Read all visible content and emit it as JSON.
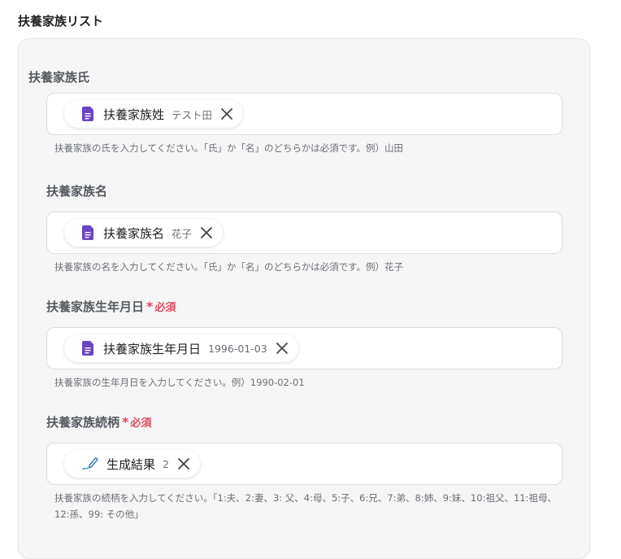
{
  "section_title": "扶養家族リスト",
  "fields": [
    {
      "label": "扶養家族氏",
      "required": false,
      "chip": {
        "icon": "document-icon",
        "label": "扶養家族姓",
        "value": "テスト田"
      },
      "help": "扶養家族の氏を入力してください。「氏」か「名」のどちらかは必須です。例）山田"
    },
    {
      "label": "扶養家族名",
      "required": false,
      "chip": {
        "icon": "document-icon",
        "label": "扶養家族名",
        "value": "花子"
      },
      "help": "扶養家族の名を入力してください。「氏」か「名」のどちらかは必須です。例）花子"
    },
    {
      "label": "扶養家族生年月日",
      "required": true,
      "required_text": "必須",
      "chip": {
        "icon": "document-icon",
        "label": "扶養家族生年月日",
        "value": "1996-01-03"
      },
      "help": "扶養家族の生年月日を入力してください。例）1990-02-01"
    },
    {
      "label": "扶養家族続柄",
      "required": true,
      "required_text": "必須",
      "chip": {
        "icon": "pen-icon",
        "label": "生成結果",
        "value": "2"
      },
      "help": "扶養家族の続柄を入力してください。「1:夫、2:妻、3: 父、4:母、5:子、6:兄、7:弟、8:姉、9:妹、10:祖父、11:祖母、12:孫、99: その他」"
    }
  ],
  "colors": {
    "required": "#e24a5e",
    "doc_icon": "#6b46c1",
    "pen_icon": "#3b6fb6"
  }
}
